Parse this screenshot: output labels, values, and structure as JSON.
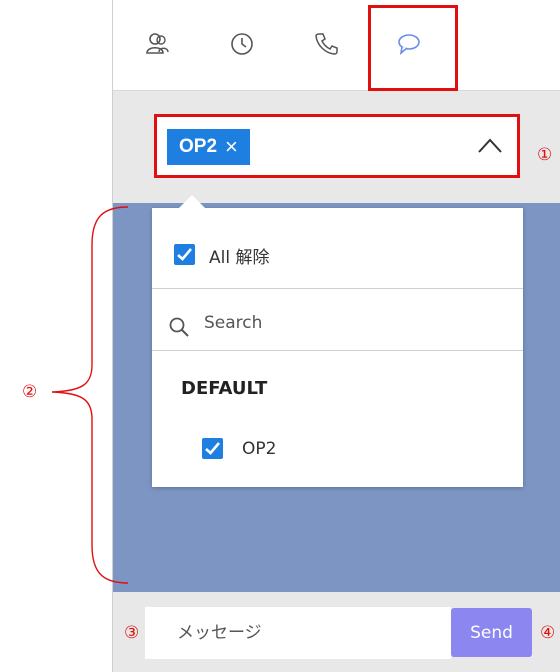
{
  "tabs": [
    {
      "icon": "contacts-icon"
    },
    {
      "icon": "history-icon"
    },
    {
      "icon": "phone-icon"
    },
    {
      "icon": "chat-icon",
      "active": true
    }
  ],
  "select": {
    "tag_label": "OP2",
    "tag_remove": "×"
  },
  "dropdown": {
    "all_label": "All 解除",
    "search_placeholder": "Search",
    "group_heading": "DEFAULT",
    "items": [
      {
        "label": "OP2",
        "checked": true
      }
    ]
  },
  "message": {
    "placeholder": "メッセージ",
    "send_label": "Send"
  },
  "callouts": {
    "c1": "①",
    "c2": "②",
    "c3": "③",
    "c4": "④"
  },
  "colors": {
    "accent_blue": "#1e7fe0",
    "chat_bg": "#7d95c3",
    "send_button": "#8b86f0",
    "highlight_red": "#e01010",
    "active_tab_icon": "#6b8de8"
  }
}
